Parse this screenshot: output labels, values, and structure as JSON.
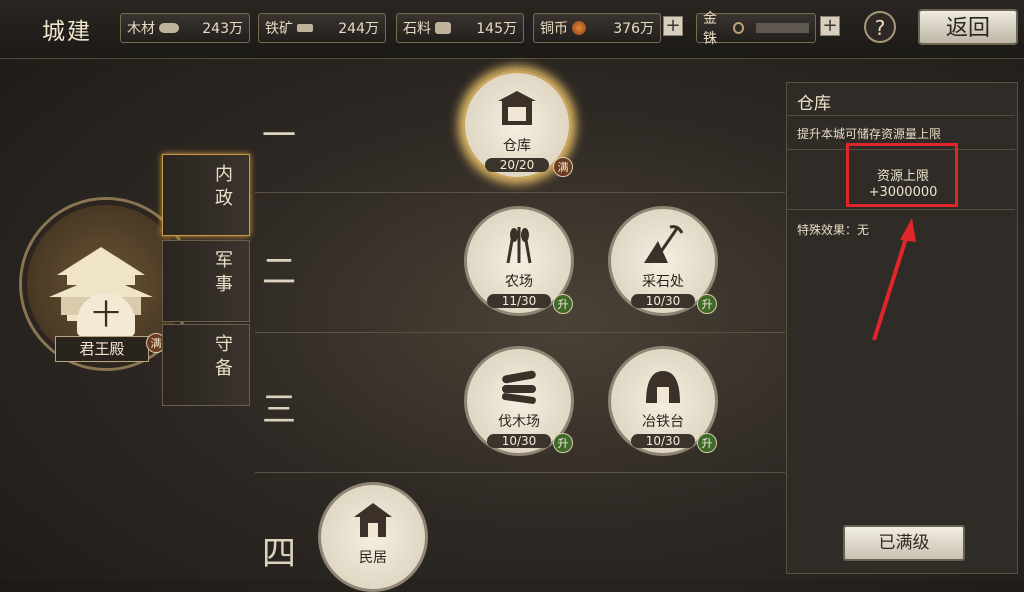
{
  "header": {
    "title": "城建",
    "resources": [
      {
        "label": "木材",
        "value": "243万",
        "icon": "wood-icon"
      },
      {
        "label": "铁矿",
        "value": "244万",
        "icon": "anvil-icon"
      },
      {
        "label": "石料",
        "value": "145万",
        "icon": "stone-icon"
      },
      {
        "label": "铜币",
        "value": "376万",
        "icon": "coin-icon"
      },
      {
        "label": "金铢",
        "value": "",
        "icon": "gold-coin-icon"
      }
    ],
    "plus": "+",
    "help": "?",
    "back": "返回"
  },
  "rows": [
    "一",
    "二",
    "三",
    "四"
  ],
  "main_hall": {
    "name": "君王殿",
    "level": "十",
    "badge": "满"
  },
  "tabs": [
    {
      "label": "内政",
      "selected": true
    },
    {
      "label": "军事",
      "selected": false
    },
    {
      "label": "守备",
      "selected": false
    }
  ],
  "buildings": [
    {
      "name": "仓库",
      "level": "20/20",
      "badge": "满",
      "icon": "warehouse-icon"
    },
    {
      "name": "农场",
      "level": "11/30",
      "badge": "升",
      "icon": "wheat-icon"
    },
    {
      "name": "采石处",
      "level": "10/30",
      "badge": "升",
      "icon": "pickaxe-icon"
    },
    {
      "name": "伐木场",
      "level": "10/30",
      "badge": "升",
      "icon": "logs-icon"
    },
    {
      "name": "冶铁台",
      "level": "10/30",
      "badge": "升",
      "icon": "furnace-icon"
    },
    {
      "name": "民居",
      "level": "",
      "badge": "",
      "icon": "house-icon"
    }
  ],
  "detail": {
    "title": "仓库",
    "description": "提升本城可储存资源量上限",
    "limit_label": "资源上限",
    "limit_value": "+3000000",
    "special_effect": "特殊效果：无",
    "button": "已满级"
  },
  "colors": {
    "highlight": "#e0262a",
    "upgrade_badge": "#3f6a2a",
    "full_badge": "#6a3b20"
  }
}
